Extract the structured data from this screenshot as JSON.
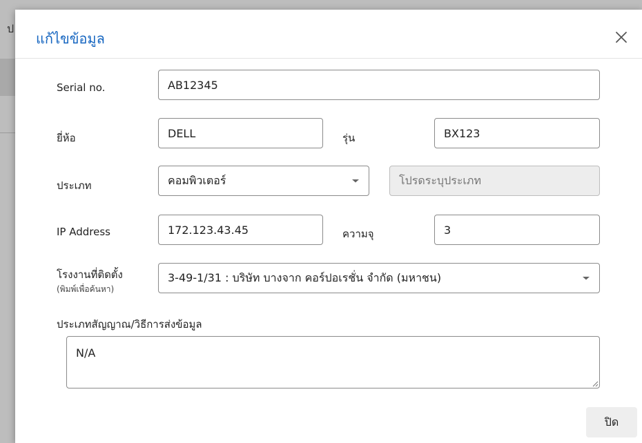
{
  "dialog": {
    "title": "แก้ไขข้อมูล",
    "close_button": "ปิด"
  },
  "form": {
    "serial": {
      "label": "Serial no.",
      "value": "AB12345"
    },
    "brand": {
      "label": "ยี่ห้อ",
      "value": "DELL"
    },
    "model": {
      "label": "รุ่น",
      "value": "BX123"
    },
    "type": {
      "label": "ประเภท",
      "value": "คอมพิวเตอร์",
      "other_placeholder": "โปรดระบุประเภท"
    },
    "ip": {
      "label": "IP Address",
      "value": "172.123.43.45"
    },
    "memory": {
      "label": "ความจุ",
      "value": "3"
    },
    "factory": {
      "label": "โรงงานที่ติดตั้ง",
      "sublabel": "(พิมพ์เพื่อค้นหา)",
      "value": "3-49-1/31 : บริษัท บางจาก คอร์ปอเรชั่น จำกัด (มหาชน)"
    },
    "signal": {
      "label": "ประเภทสัญญาณ/วิธีการส่งข้อมูล",
      "value": "N/A"
    }
  },
  "background": {
    "partial_char": "ป"
  },
  "colors": {
    "title": "#1565c0",
    "overlay": "#8e8e8e",
    "field_border": "#8a8a8a",
    "disabled_bg": "#ededed"
  }
}
